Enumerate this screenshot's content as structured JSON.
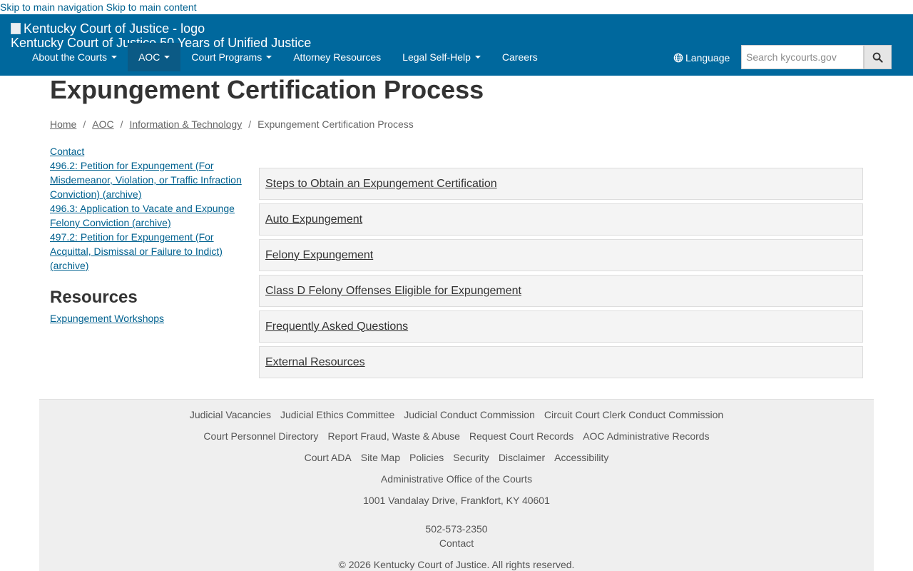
{
  "skip": {
    "nav": "Skip to main navigation",
    "content": "Skip to main content"
  },
  "header": {
    "logo_alt": "Kentucky Court of Justice - logo",
    "site_name": "Kentucky Court of Justice 50 Years of Unified Justice",
    "nav": [
      {
        "label": "About the Courts"
      },
      {
        "label": "AOC"
      },
      {
        "label": "Court Programs"
      },
      {
        "label": "Attorney Resources"
      },
      {
        "label": "Legal Self-Help"
      },
      {
        "label": "Careers"
      }
    ],
    "language": "Language",
    "search_placeholder": "Search kycourts.gov"
  },
  "page": {
    "title": "Expungement Certification Process",
    "breadcrumb": [
      "Home",
      "AOC",
      "Information & Technology",
      "Expungement Certification Process"
    ]
  },
  "sidebar": {
    "links": [
      "Contact",
      "496.2: Petition for Expungement (For Misdemeanor, Violation, or Traffic Infraction Conviction) (archive)",
      "496.3: Application to Vacate and Expunge Felony Conviction (archive)",
      "497.2: Petition for Expungement (For Acquittal, Dismissal or Failure to Indict) (archive)"
    ],
    "resources_heading": "Resources",
    "resources_link": "Expungement Workshops"
  },
  "accordion": [
    "Steps to Obtain an Expungement Certification",
    "Auto Expungement",
    "Felony Expungement",
    "Class D Felony Offenses Eligible for Expungement",
    "Frequently Asked Questions",
    "External Resources"
  ],
  "footer": {
    "row1": [
      "Judicial Vacancies",
      "Judicial Ethics Committee",
      "Judicial Conduct Commission",
      "Circuit Court Clerk Conduct Commission"
    ],
    "row2": [
      "Court Personnel Directory",
      "Report Fraud, Waste & Abuse",
      "Request Court Records",
      "AOC Administrative Records"
    ],
    "row3": [
      "Court ADA",
      "Site Map",
      "Policies",
      "Security",
      "Disclaimer",
      "Accessibility"
    ],
    "org": "Administrative Office of the Courts",
    "address": "1001 Vandalay Drive, Frankfort, KY 40601",
    "phone": "502-573-2350",
    "contact": "Contact",
    "copyright": "© 2026 Kentucky Court of Justice. All rights reserved."
  },
  "colors": {
    "header_bg": "#00689d",
    "link": "#00618f",
    "footer_bg": "#efefef"
  }
}
